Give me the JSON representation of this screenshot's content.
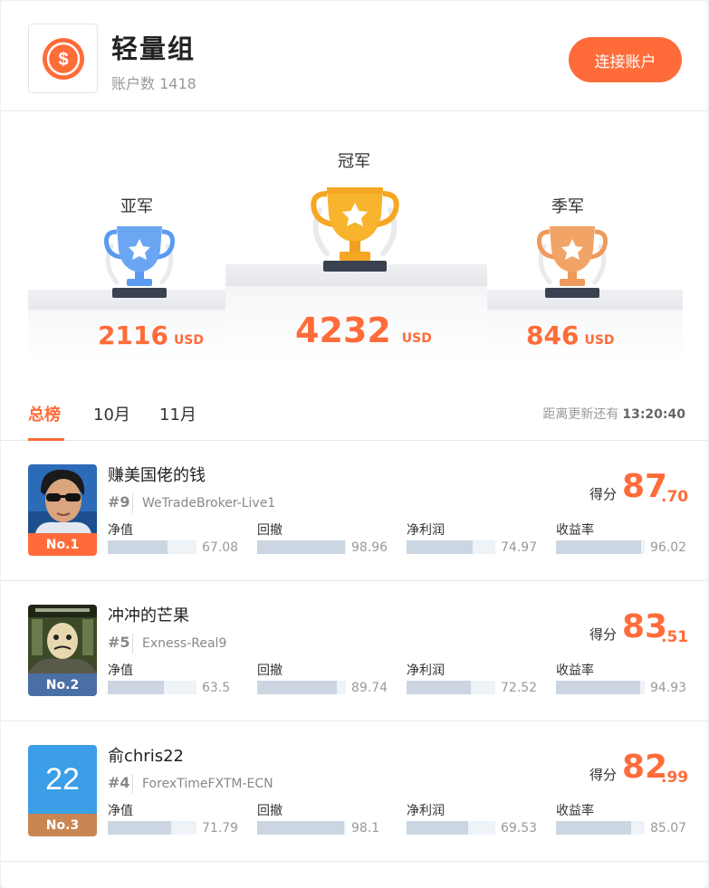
{
  "header": {
    "title": "轻量组",
    "account_count_label": "账户数 1418",
    "connect_button": "连接账户",
    "logo_icon": "dollar-coin-icon"
  },
  "podium": {
    "champion": {
      "label": "冠军",
      "amount": "4232",
      "unit": "USD",
      "trophy_color": "#f5a623"
    },
    "runner_up": {
      "label": "亚军",
      "amount": "2116",
      "unit": "USD",
      "trophy_color": "#5b9bef"
    },
    "third": {
      "label": "季军",
      "amount": "846",
      "unit": "USD",
      "trophy_color": "#ee9a5a"
    }
  },
  "tabs": {
    "items": [
      {
        "label": "总榜",
        "active": true
      },
      {
        "label": "10月",
        "active": false
      },
      {
        "label": "11月",
        "active": false
      }
    ],
    "countdown_label": "距离更新还有",
    "countdown_value": "13:20:40"
  },
  "colors": {
    "accent": "#ff6c3a",
    "no1_tag": "#ff6c3a",
    "no2_tag": "#4a6fa5",
    "no3_tag": "#c98552"
  },
  "entries": [
    {
      "name": "赚美国佬的钱",
      "rank": "#9",
      "broker": "WeTradeBroker-Live1",
      "score_label": "得分",
      "score_int": "87",
      "score_dec": ".70",
      "tag": "No.1",
      "avatar_text": "",
      "metrics": [
        {
          "label": "净值",
          "value": "67.08",
          "fill": 0.6708
        },
        {
          "label": "回撤",
          "value": "98.96",
          "fill": 0.9896
        },
        {
          "label": "净利润",
          "value": "74.97",
          "fill": 0.7497
        },
        {
          "label": "收益率",
          "value": "96.02",
          "fill": 0.9602
        }
      ]
    },
    {
      "name": "冲冲的芒果",
      "rank": "#5",
      "broker": "Exness-Real9",
      "score_label": "得分",
      "score_int": "83",
      "score_dec": ".51",
      "tag": "No.2",
      "avatar_text": "",
      "metrics": [
        {
          "label": "净值",
          "value": "63.5",
          "fill": 0.635
        },
        {
          "label": "回撤",
          "value": "89.74",
          "fill": 0.8974
        },
        {
          "label": "净利润",
          "value": "72.52",
          "fill": 0.7252
        },
        {
          "label": "收益率",
          "value": "94.93",
          "fill": 0.9493
        }
      ]
    },
    {
      "name": "俞chris22",
      "rank": "#4",
      "broker": "ForexTimeFXTM-ECN",
      "score_label": "得分",
      "score_int": "82",
      "score_dec": ".99",
      "tag": "No.3",
      "avatar_text": "22",
      "metrics": [
        {
          "label": "净值",
          "value": "71.79",
          "fill": 0.7179
        },
        {
          "label": "回撤",
          "value": "98.1",
          "fill": 0.981
        },
        {
          "label": "净利润",
          "value": "69.53",
          "fill": 0.6953
        },
        {
          "label": "收益率",
          "value": "85.07",
          "fill": 0.8507
        }
      ]
    }
  ]
}
